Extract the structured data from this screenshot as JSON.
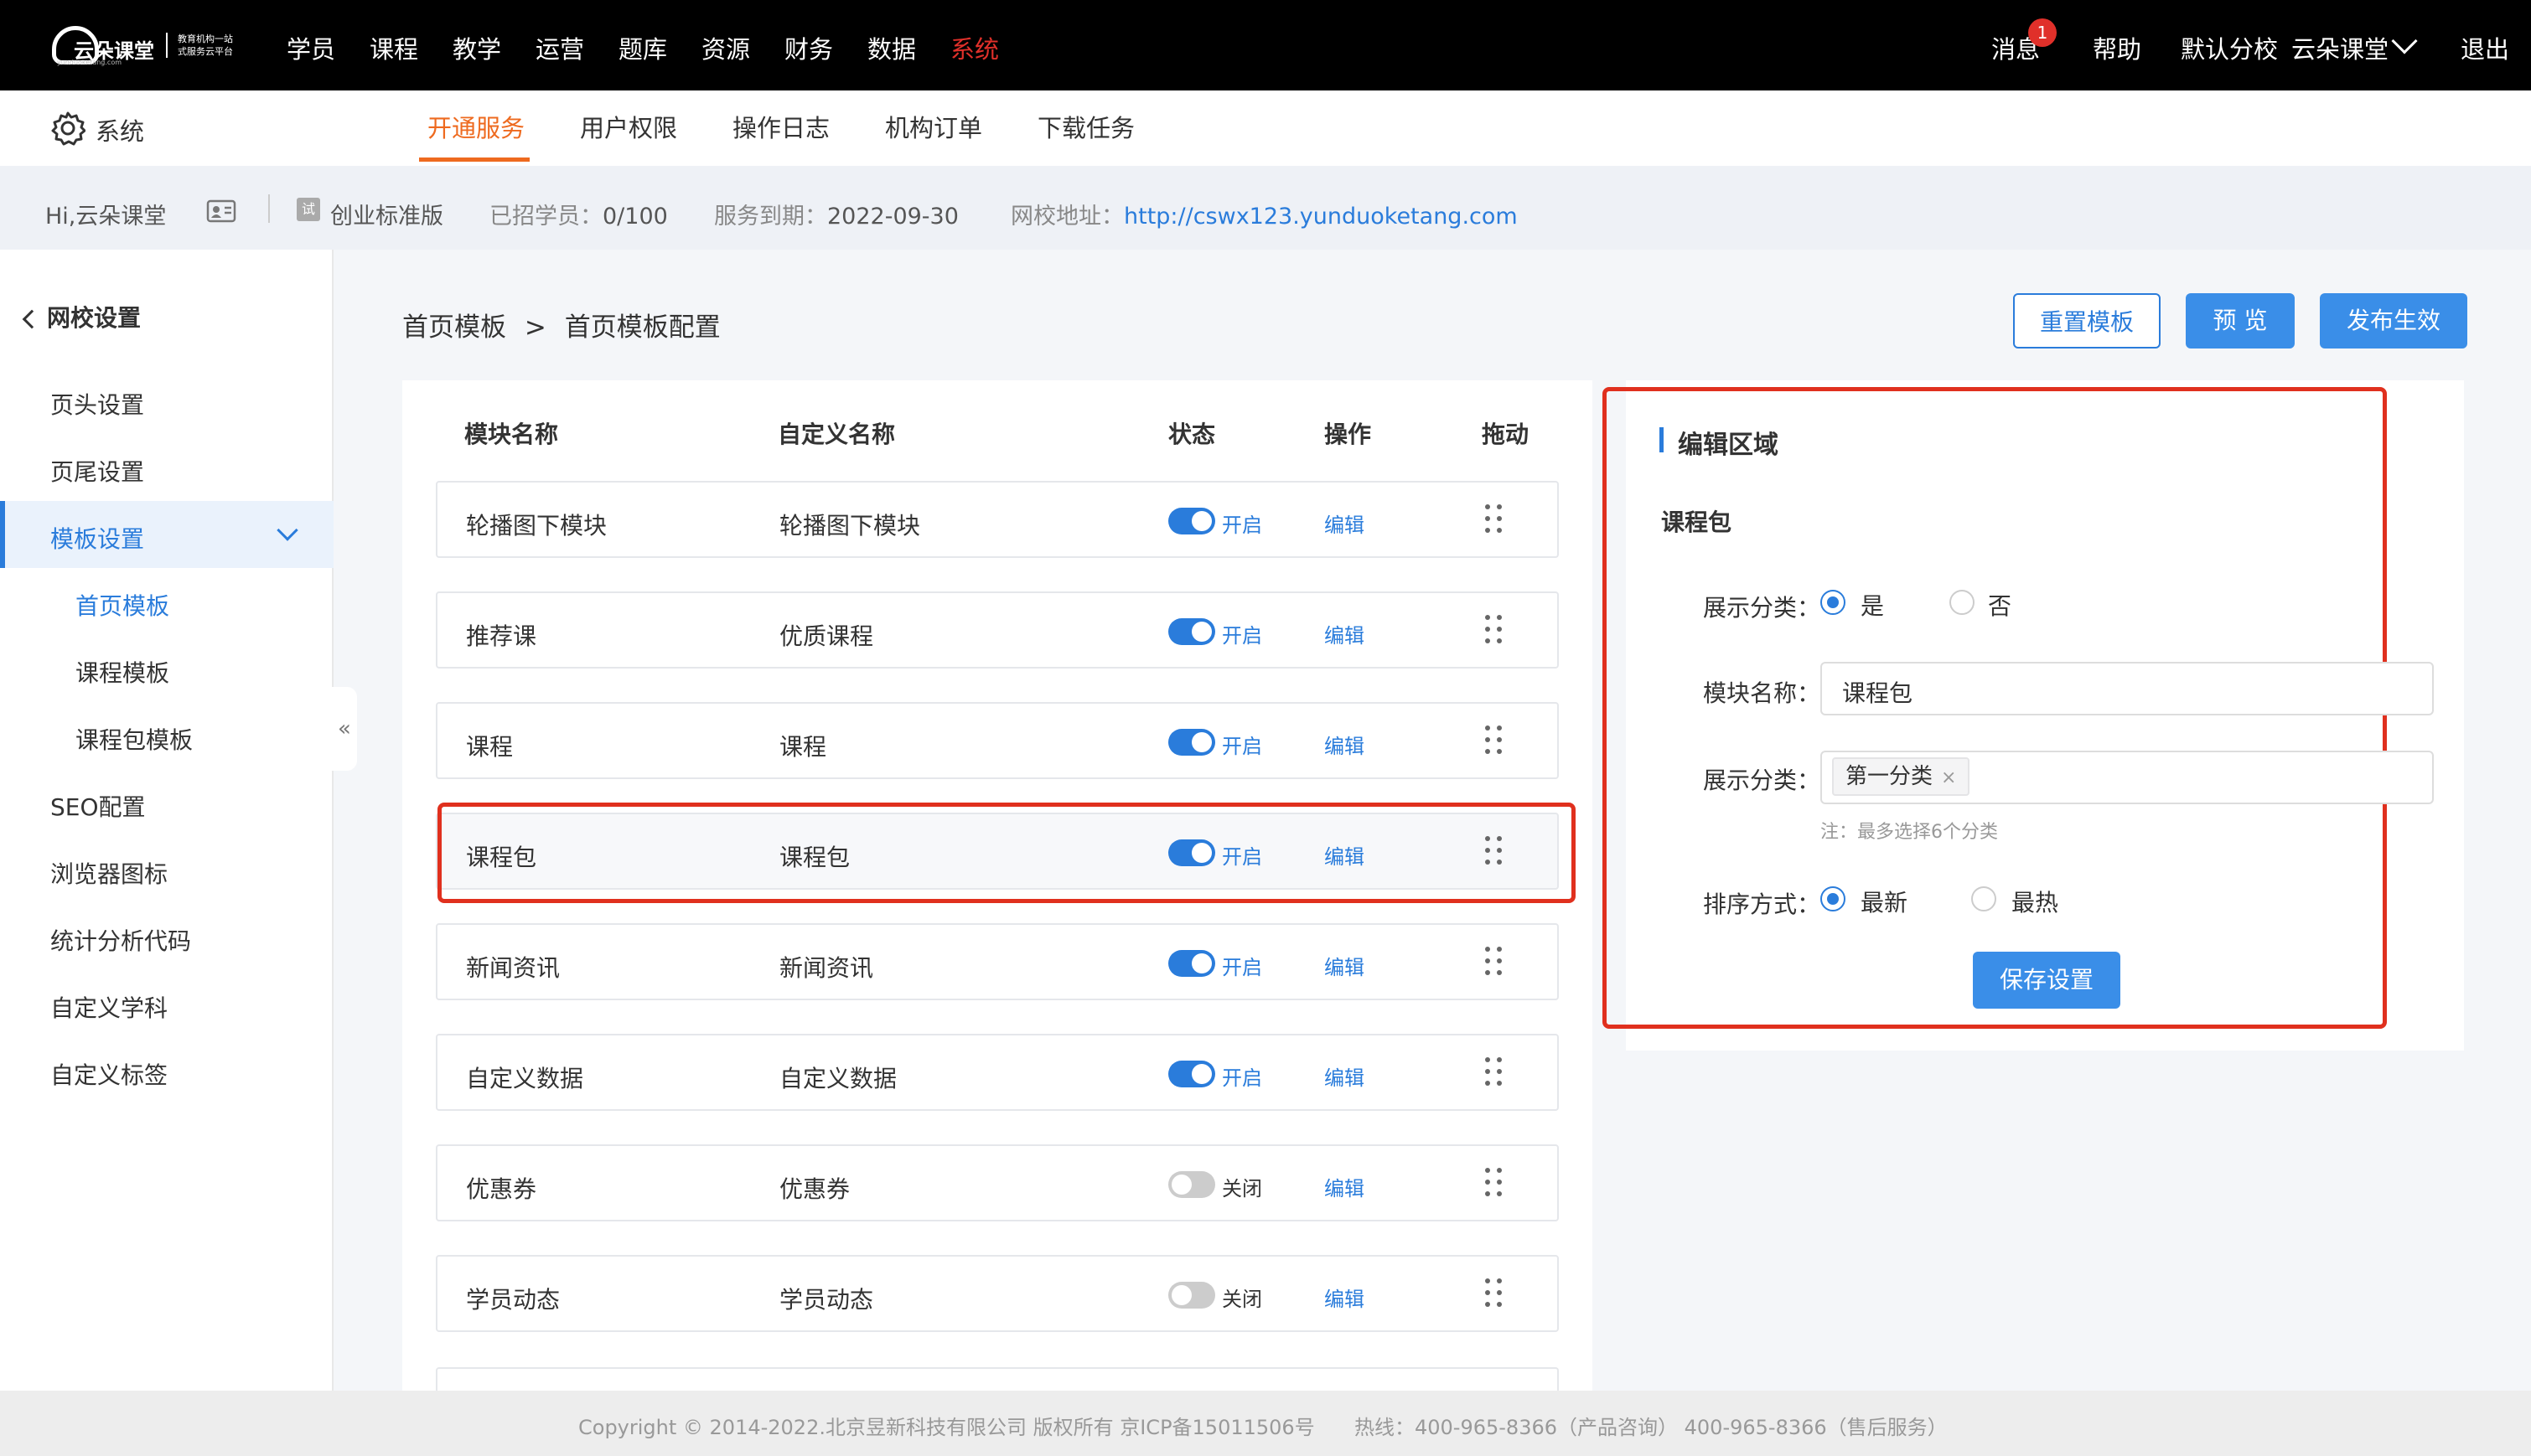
{
  "brand": {
    "name": "云朵课堂",
    "tagline1": "教育机构一站",
    "tagline2": "式服务云平台",
    "domain": "yunduoketang.com"
  },
  "nav": [
    "学员",
    "课程",
    "教学",
    "运营",
    "题库",
    "资源",
    "财务",
    "数据",
    "系统"
  ],
  "top_right": {
    "msg": "消息",
    "badge": "1",
    "help": "帮助",
    "school": "默认分校",
    "user": "云朵课堂",
    "logout": "退出"
  },
  "subnav": {
    "section": "系统",
    "tabs": [
      "开通服务",
      "用户权限",
      "操作日志",
      "机构订单",
      "下载任务"
    ]
  },
  "info": {
    "greeting": "Hi,云朵课堂",
    "edition_badge": "试",
    "edition": "创业标准版",
    "students_label": "已招学员：",
    "students": "0/100",
    "expire_label": "服务到期：",
    "expire": "2022-09-30",
    "url_label": "网校地址：",
    "url": "http://cswx123.yunduoketang.com"
  },
  "sidebar": {
    "back": "网校设置",
    "items": [
      "页头设置",
      "页尾设置",
      "模板设置",
      "首页模板",
      "课程模板",
      "课程包模板",
      "SEO配置",
      "浏览器图标",
      "统计分析代码",
      "自定义学科",
      "自定义标签"
    ],
    "collapse": "«"
  },
  "breadcrumb": {
    "parent": "首页模板",
    "sep": ">",
    "current": "首页模板配置"
  },
  "actions": {
    "reset": "重置模板",
    "preview": "预 览",
    "publish": "发布生效"
  },
  "table": {
    "headers": [
      "模块名称",
      "自定义名称",
      "状态",
      "操作",
      "拖动"
    ],
    "rows": [
      {
        "name": "轮播图下模块",
        "custom": "轮播图下模块",
        "status": "开启",
        "on": true,
        "op": "编辑"
      },
      {
        "name": "推荐课",
        "custom": "优质课程",
        "status": "开启",
        "on": true,
        "op": "编辑"
      },
      {
        "name": "课程",
        "custom": "课程",
        "status": "开启",
        "on": true,
        "op": "编辑"
      },
      {
        "name": "课程包",
        "custom": "课程包",
        "status": "开启",
        "on": true,
        "op": "编辑"
      },
      {
        "name": "新闻资讯",
        "custom": "新闻资讯",
        "status": "开启",
        "on": true,
        "op": "编辑"
      },
      {
        "name": "自定义数据",
        "custom": "自定义数据",
        "status": "开启",
        "on": true,
        "op": "编辑"
      },
      {
        "name": "优惠券",
        "custom": "优惠券",
        "status": "关闭",
        "on": false,
        "op": "编辑"
      },
      {
        "name": "学员动态",
        "custom": "学员动态",
        "status": "关闭",
        "on": false,
        "op": "编辑"
      }
    ]
  },
  "edit": {
    "title": "编辑区域",
    "module": "课程包",
    "show_cat_label": "展示分类：",
    "yes": "是",
    "no": "否",
    "name_label": "模块名称：",
    "name_value": "课程包",
    "cat_label": "展示分类：",
    "cat_tag": "第一分类",
    "note": "注：最多选择6个分类",
    "sort_label": "排序方式：",
    "newest": "最新",
    "hottest": "最热",
    "save": "保存设置"
  },
  "footer": {
    "copyright": "Copyright © 2014-2022.北京昱新科技有限公司 版权所有 京ICP备15011506号",
    "hotline": "热线：400-965-8366（产品咨询） 400-965-8366（售后服务）"
  }
}
